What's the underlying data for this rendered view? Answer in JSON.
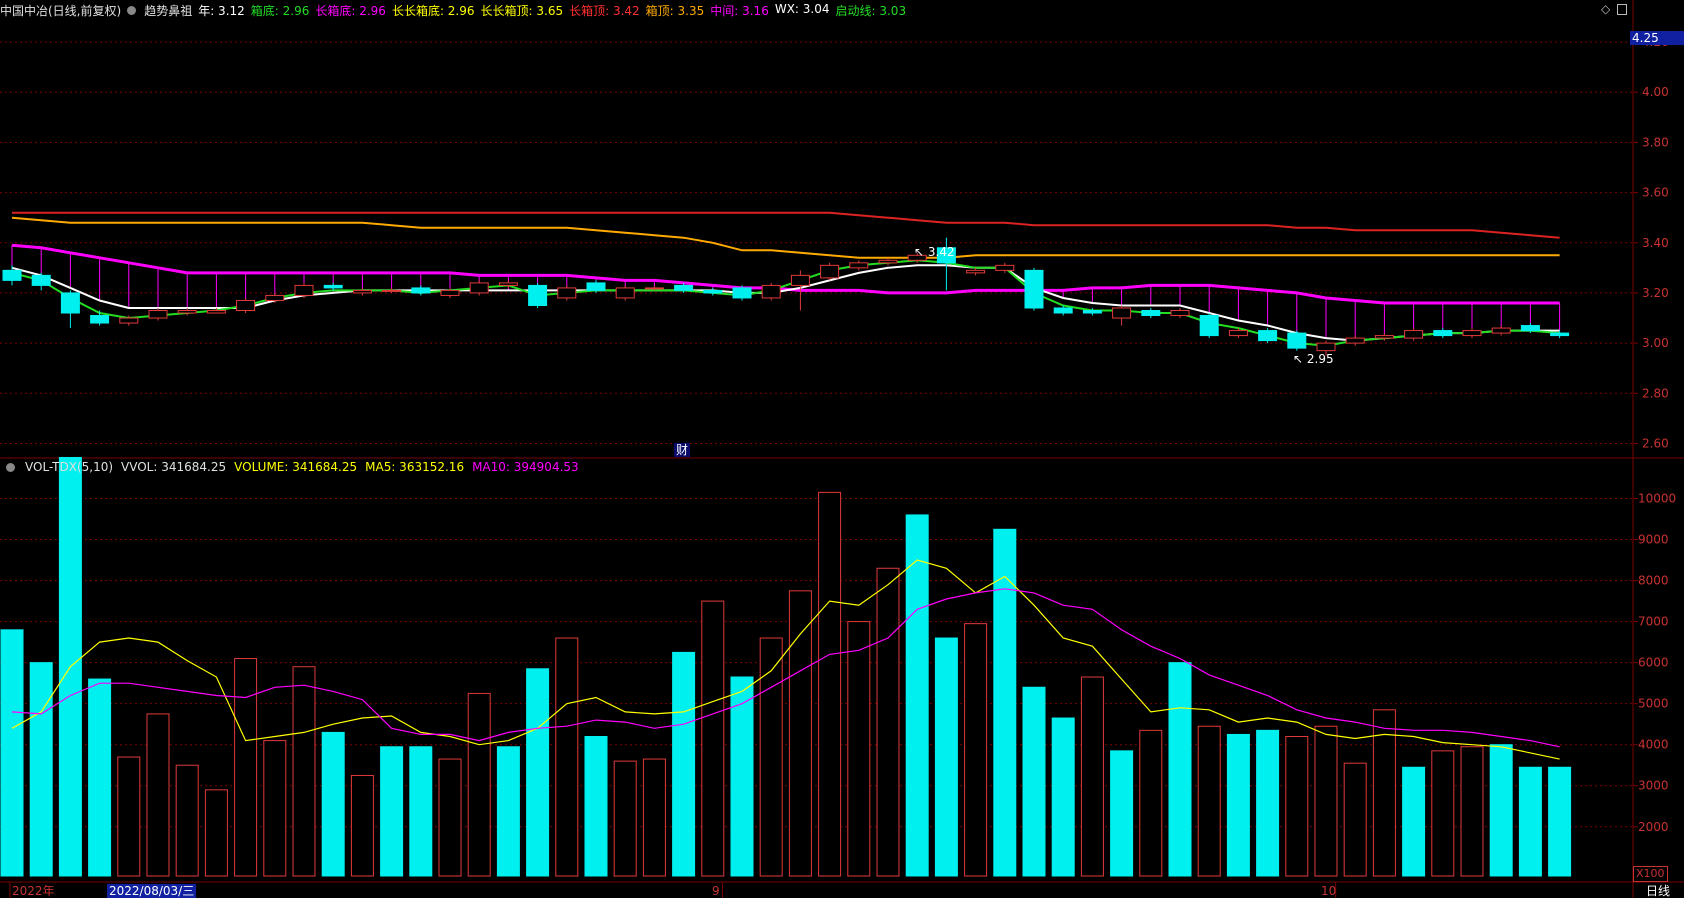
{
  "colors": {
    "background": "#000000",
    "grid": "#7a0000",
    "axis_text": "#c83232",
    "up": "#e03a3a",
    "down": "#00f0f0",
    "white_line": "#ffffff",
    "green_line": "#22dd22",
    "magenta_line": "#ff00ff",
    "orange_line": "#ffaa00",
    "red_line": "#dd2222",
    "yellow_line": "#ffff00"
  },
  "header": {
    "stock": "中国中冶(日线,前复权)",
    "indicator_icon": "circle-dropdown-icon",
    "indicator": "趋势鼻祖",
    "items": [
      {
        "label": "年: 3.12",
        "color": "#ffffff"
      },
      {
        "label": "箱底: 2.96",
        "color": "#22dd22"
      },
      {
        "label": "长箱底: 2.96",
        "color": "#ff00ff"
      },
      {
        "label": "长长箱底: 2.96",
        "color": "#ffff00"
      },
      {
        "label": "长长箱顶: 3.65",
        "color": "#ffff00"
      },
      {
        "label": "长箱顶: 3.42",
        "color": "#ff3030"
      },
      {
        "label": "箱顶: 3.35",
        "color": "#ffaa00"
      },
      {
        "label": "中间: 3.16",
        "color": "#ff00ff"
      },
      {
        "label": "WX: 3.04",
        "color": "#ffffff"
      },
      {
        "label": "启动线: 3.03",
        "color": "#22dd22"
      }
    ],
    "right_icons": [
      "diamond-icon",
      "window-icon"
    ]
  },
  "price_panel": {
    "current_price_tag": "4.25",
    "ticks": [
      "4.20",
      "4.00",
      "3.80",
      "3.60",
      "3.40",
      "3.20",
      "3.00",
      "2.80",
      "2.60"
    ],
    "high_note": "3.42",
    "low_note": "2.95",
    "marker": "财"
  },
  "volume_panel": {
    "title": "VOL-TDX(5,10)",
    "vvol": "VVOL: 341684.25",
    "volume": "VOLUME: 341684.25",
    "ma5": "MA5: 363152.16",
    "ma10": "MA10: 394904.53",
    "ticks": [
      "10000",
      "9000",
      "8000",
      "7000",
      "6000",
      "5000",
      "4000",
      "3000",
      "2000"
    ],
    "unit": "X100"
  },
  "footer": {
    "labels": [
      "2022年",
      "2022/08/03/三",
      "9",
      "10"
    ],
    "period": "日线"
  },
  "chart_data": [
    {
      "type": "candlestick",
      "title": "中国中冶(日线,前复权)",
      "ylim": [
        2.55,
        4.28
      ],
      "candles": [
        {
          "o": 3.29,
          "c": 3.25,
          "h": 3.31,
          "l": 3.23
        },
        {
          "o": 3.27,
          "c": 3.23,
          "h": 3.28,
          "l": 3.21
        },
        {
          "o": 3.2,
          "c": 3.12,
          "h": 3.21,
          "l": 3.06
        },
        {
          "o": 3.11,
          "c": 3.08,
          "h": 3.13,
          "l": 3.07
        },
        {
          "o": 3.08,
          "c": 3.1,
          "h": 3.11,
          "l": 3.07
        },
        {
          "o": 3.1,
          "c": 3.13,
          "h": 3.14,
          "l": 3.09
        },
        {
          "o": 3.12,
          "c": 3.13,
          "h": 3.14,
          "l": 3.11
        },
        {
          "o": 3.12,
          "c": 3.13,
          "h": 3.14,
          "l": 3.12
        },
        {
          "o": 3.13,
          "c": 3.17,
          "h": 3.18,
          "l": 3.12
        },
        {
          "o": 3.17,
          "c": 3.19,
          "h": 3.2,
          "l": 3.16
        },
        {
          "o": 3.19,
          "c": 3.23,
          "h": 3.24,
          "l": 3.18
        },
        {
          "o": 3.23,
          "c": 3.22,
          "h": 3.24,
          "l": 3.21
        },
        {
          "o": 3.2,
          "c": 3.21,
          "h": 3.22,
          "l": 3.19
        },
        {
          "o": 3.21,
          "c": 3.21,
          "h": 3.22,
          "l": 3.2
        },
        {
          "o": 3.22,
          "c": 3.2,
          "h": 3.23,
          "l": 3.19
        },
        {
          "o": 3.19,
          "c": 3.21,
          "h": 3.22,
          "l": 3.18
        },
        {
          "o": 3.2,
          "c": 3.24,
          "h": 3.25,
          "l": 3.19
        },
        {
          "o": 3.23,
          "c": 3.24,
          "h": 3.25,
          "l": 3.22
        },
        {
          "o": 3.23,
          "c": 3.15,
          "h": 3.24,
          "l": 3.14
        },
        {
          "o": 3.18,
          "c": 3.22,
          "h": 3.23,
          "l": 3.17
        },
        {
          "o": 3.24,
          "c": 3.21,
          "h": 3.25,
          "l": 3.2
        },
        {
          "o": 3.18,
          "c": 3.22,
          "h": 3.23,
          "l": 3.17
        },
        {
          "o": 3.22,
          "c": 3.22,
          "h": 3.23,
          "l": 3.21
        },
        {
          "o": 3.23,
          "c": 3.21,
          "h": 3.24,
          "l": 3.2
        },
        {
          "o": 3.21,
          "c": 3.2,
          "h": 3.22,
          "l": 3.19
        },
        {
          "o": 3.22,
          "c": 3.18,
          "h": 3.23,
          "l": 3.17
        },
        {
          "o": 3.18,
          "c": 3.23,
          "h": 3.24,
          "l": 3.17
        },
        {
          "o": 3.23,
          "c": 3.27,
          "h": 3.29,
          "l": 3.13
        },
        {
          "o": 3.26,
          "c": 3.31,
          "h": 3.32,
          "l": 3.25
        },
        {
          "o": 3.3,
          "c": 3.32,
          "h": 3.33,
          "l": 3.29
        },
        {
          "o": 3.32,
          "c": 3.33,
          "h": 3.34,
          "l": 3.31
        },
        {
          "o": 3.33,
          "c": 3.35,
          "h": 3.36,
          "l": 3.32
        },
        {
          "o": 3.38,
          "c": 3.32,
          "h": 3.42,
          "l": 3.21
        },
        {
          "o": 3.28,
          "c": 3.29,
          "h": 3.3,
          "l": 3.27
        },
        {
          "o": 3.29,
          "c": 3.31,
          "h": 3.32,
          "l": 3.28
        },
        {
          "o": 3.29,
          "c": 3.14,
          "h": 3.3,
          "l": 3.13
        },
        {
          "o": 3.14,
          "c": 3.12,
          "h": 3.15,
          "l": 3.11
        },
        {
          "o": 3.13,
          "c": 3.12,
          "h": 3.14,
          "l": 3.11
        },
        {
          "o": 3.1,
          "c": 3.14,
          "h": 3.15,
          "l": 3.07
        },
        {
          "o": 3.13,
          "c": 3.11,
          "h": 3.14,
          "l": 3.1
        },
        {
          "o": 3.11,
          "c": 3.13,
          "h": 3.14,
          "l": 3.1
        },
        {
          "o": 3.11,
          "c": 3.03,
          "h": 3.12,
          "l": 3.02
        },
        {
          "o": 3.03,
          "c": 3.05,
          "h": 3.06,
          "l": 3.02
        },
        {
          "o": 3.05,
          "c": 3.01,
          "h": 3.06,
          "l": 3.0
        },
        {
          "o": 3.04,
          "c": 2.98,
          "h": 3.05,
          "l": 2.97
        },
        {
          "o": 2.97,
          "c": 3.0,
          "h": 3.01,
          "l": 2.95
        },
        {
          "o": 3.0,
          "c": 3.02,
          "h": 3.03,
          "l": 2.99
        },
        {
          "o": 3.02,
          "c": 3.03,
          "h": 3.04,
          "l": 3.01
        },
        {
          "o": 3.02,
          "c": 3.05,
          "h": 3.06,
          "l": 3.01
        },
        {
          "o": 3.05,
          "c": 3.03,
          "h": 3.06,
          "l": 3.02
        },
        {
          "o": 3.03,
          "c": 3.05,
          "h": 3.06,
          "l": 3.02
        },
        {
          "o": 3.04,
          "c": 3.06,
          "h": 3.07,
          "l": 3.03
        },
        {
          "o": 3.07,
          "c": 3.05,
          "h": 3.08,
          "l": 3.04
        },
        {
          "o": 3.04,
          "c": 3.03,
          "h": 3.05,
          "l": 3.02
        }
      ],
      "lines": [
        {
          "name": "长箱顶",
          "color": "#dd2222",
          "values": [
            3.52,
            3.52,
            3.52,
            3.52,
            3.52,
            3.52,
            3.52,
            3.52,
            3.52,
            3.52,
            3.52,
            3.52,
            3.52,
            3.52,
            3.52,
            3.52,
            3.52,
            3.52,
            3.52,
            3.52,
            3.52,
            3.52,
            3.52,
            3.52,
            3.52,
            3.52,
            3.52,
            3.52,
            3.52,
            3.51,
            3.5,
            3.49,
            3.48,
            3.48,
            3.48,
            3.47,
            3.47,
            3.47,
            3.47,
            3.47,
            3.47,
            3.47,
            3.47,
            3.47,
            3.46,
            3.46,
            3.45,
            3.45,
            3.45,
            3.45,
            3.45,
            3.44,
            3.43,
            3.42
          ]
        },
        {
          "name": "箱顶",
          "color": "#ffaa00",
          "values": [
            3.5,
            3.49,
            3.48,
            3.48,
            3.48,
            3.48,
            3.48,
            3.48,
            3.48,
            3.48,
            3.48,
            3.48,
            3.48,
            3.47,
            3.46,
            3.46,
            3.46,
            3.46,
            3.46,
            3.46,
            3.45,
            3.44,
            3.43,
            3.42,
            3.4,
            3.37,
            3.37,
            3.36,
            3.35,
            3.34,
            3.34,
            3.34,
            3.34,
            3.35,
            3.35,
            3.35,
            3.35,
            3.35,
            3.35,
            3.35,
            3.35,
            3.35,
            3.35,
            3.35,
            3.35,
            3.35,
            3.35,
            3.35,
            3.35,
            3.35,
            3.35,
            3.35,
            3.35,
            3.35
          ]
        },
        {
          "name": "中间",
          "color": "#ff00ff",
          "values": [
            3.39,
            3.38,
            3.36,
            3.34,
            3.32,
            3.3,
            3.28,
            3.28,
            3.28,
            3.28,
            3.28,
            3.28,
            3.28,
            3.28,
            3.28,
            3.28,
            3.27,
            3.27,
            3.27,
            3.27,
            3.26,
            3.25,
            3.25,
            3.24,
            3.23,
            3.22,
            3.22,
            3.21,
            3.21,
            3.21,
            3.2,
            3.2,
            3.2,
            3.21,
            3.21,
            3.21,
            3.21,
            3.22,
            3.22,
            3.23,
            3.23,
            3.23,
            3.22,
            3.21,
            3.2,
            3.18,
            3.17,
            3.16,
            3.16,
            3.16,
            3.16,
            3.16,
            3.16,
            3.16
          ]
        },
        {
          "name": "年",
          "color": "#ffffff",
          "values": [
            3.3,
            3.27,
            3.22,
            3.17,
            3.14,
            3.14,
            3.14,
            3.14,
            3.14,
            3.17,
            3.19,
            3.2,
            3.21,
            3.21,
            3.21,
            3.21,
            3.21,
            3.21,
            3.21,
            3.21,
            3.21,
            3.21,
            3.21,
            3.21,
            3.21,
            3.2,
            3.2,
            3.22,
            3.25,
            3.28,
            3.3,
            3.31,
            3.31,
            3.3,
            3.3,
            3.22,
            3.18,
            3.16,
            3.15,
            3.15,
            3.15,
            3.12,
            3.09,
            3.07,
            3.04,
            3.02,
            3.01,
            3.02,
            3.03,
            3.04,
            3.04,
            3.05,
            3.05,
            3.05
          ]
        },
        {
          "name": "启动线",
          "color": "#22dd22",
          "values": [
            3.28,
            3.25,
            3.18,
            3.12,
            3.1,
            3.11,
            3.12,
            3.13,
            3.15,
            3.18,
            3.2,
            3.21,
            3.21,
            3.21,
            3.2,
            3.21,
            3.22,
            3.23,
            3.19,
            3.2,
            3.21,
            3.21,
            3.21,
            3.21,
            3.2,
            3.19,
            3.21,
            3.25,
            3.29,
            3.31,
            3.32,
            3.33,
            3.32,
            3.3,
            3.3,
            3.2,
            3.15,
            3.13,
            3.13,
            3.12,
            3.12,
            3.08,
            3.06,
            3.03,
            3.0,
            2.99,
            3.01,
            3.02,
            3.03,
            3.04,
            3.04,
            3.05,
            3.05,
            3.04
          ]
        }
      ],
      "annotations": [
        {
          "text": "3.42",
          "x_index": 32,
          "y": 3.42
        },
        {
          "text": "2.95",
          "x_index": 45,
          "y": 2.95
        }
      ]
    },
    {
      "type": "bar",
      "title": "VOL-TDX(5,10)",
      "ylabel": "X100",
      "ylim": [
        800,
        10500
      ],
      "volumes": [
        6800,
        6000,
        11000,
        5600,
        3700,
        4750,
        3500,
        2900,
        6100,
        4100,
        5900,
        4300,
        3250,
        3950,
        3950,
        3650,
        5250,
        3950,
        5850,
        6600,
        4200,
        3600,
        3650,
        6250,
        7500,
        5650,
        6600,
        7750,
        10150,
        7000,
        8300,
        9600,
        6600,
        6950,
        9250,
        5400,
        4650,
        5650,
        3850,
        4350,
        6000,
        4450,
        4250,
        4350,
        4200,
        4450,
        3550,
        4850,
        3450,
        3850,
        3950,
        4000,
        3450,
        3450
      ],
      "direction": [
        "down",
        "down",
        "down",
        "down",
        "up",
        "up",
        "up",
        "up",
        "up",
        "up",
        "up",
        "down",
        "up",
        "down",
        "down",
        "up",
        "up",
        "down",
        "down",
        "up",
        "down",
        "up",
        "up",
        "down",
        "up",
        "down",
        "up",
        "up",
        "up",
        "up",
        "up",
        "down",
        "down",
        "up",
        "down",
        "down",
        "down",
        "up",
        "down",
        "up",
        "down",
        "up",
        "down",
        "down",
        "up",
        "up",
        "up",
        "up",
        "down",
        "up",
        "up",
        "down",
        "down",
        "down"
      ],
      "ma5": [
        4400,
        4800,
        5900,
        6500,
        6600,
        6500,
        6050,
        5650,
        4100,
        4200,
        4300,
        4500,
        4650,
        4700,
        4300,
        4200,
        4000,
        4100,
        4400,
        5000,
        5150,
        4800,
        4750,
        4800,
        5050,
        5300,
        5800,
        6700,
        7500,
        7400,
        7900,
        8500,
        8300,
        7700,
        8100,
        7400,
        6600,
        6400,
        5600,
        4800,
        4900,
        4850,
        4550,
        4650,
        4550,
        4250,
        4150,
        4250,
        4200,
        4050,
        4000,
        3950,
        3800,
        3650
      ],
      "ma10": [
        4800,
        4750,
        5200,
        5500,
        5500,
        5400,
        5300,
        5200,
        5150,
        5400,
        5450,
        5300,
        5100,
        4400,
        4250,
        4250,
        4100,
        4300,
        4400,
        4450,
        4600,
        4550,
        4400,
        4500,
        4750,
        5000,
        5400,
        5800,
        6200,
        6300,
        6600,
        7300,
        7550,
        7700,
        7800,
        7700,
        7400,
        7300,
        6800,
        6400,
        6100,
        5700,
        5450,
        5200,
        4850,
        4650,
        4550,
        4400,
        4350,
        4350,
        4300,
        4200,
        4100,
        3950
      ]
    }
  ]
}
